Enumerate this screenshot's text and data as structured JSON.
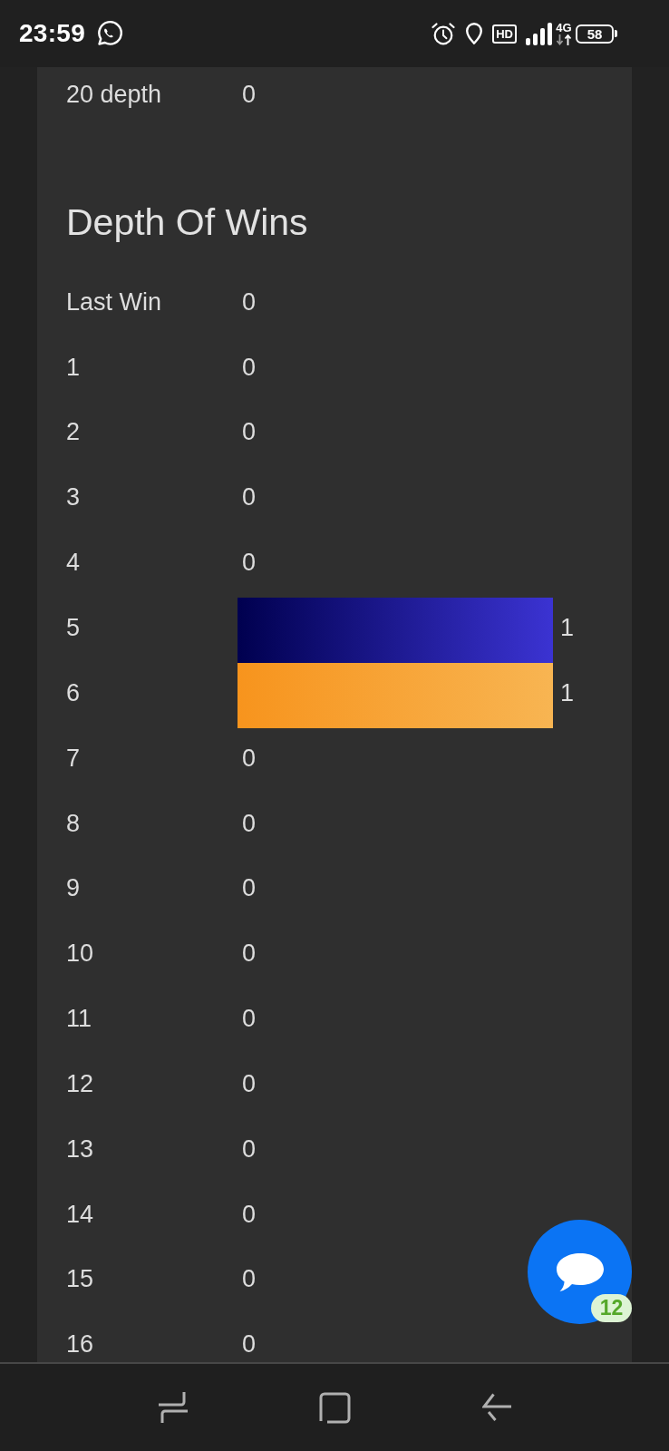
{
  "status_bar": {
    "time": "23:59",
    "hd": "HD",
    "network": "4G",
    "battery": "58"
  },
  "previous_section": {
    "rows": [
      {
        "label": "20 depth",
        "count": "0",
        "kind": "plain"
      }
    ]
  },
  "depth_of_wins": {
    "title": "Depth Of Wins",
    "rows": [
      {
        "label": "Last Win",
        "count": "0",
        "kind": "plain"
      },
      {
        "label": "1",
        "count": "0",
        "kind": "plain"
      },
      {
        "label": "2",
        "count": "0",
        "kind": "plain"
      },
      {
        "label": "3",
        "count": "0",
        "kind": "plain"
      },
      {
        "label": "4",
        "count": "0",
        "kind": "plain"
      },
      {
        "label": "5",
        "count": "1",
        "kind": "bar",
        "color": "#00004f"
      },
      {
        "label": "6",
        "count": "1",
        "kind": "bar",
        "color": "#f7941d"
      },
      {
        "label": "7",
        "count": "0",
        "kind": "plain"
      },
      {
        "label": "8",
        "count": "0",
        "kind": "plain"
      },
      {
        "label": "9",
        "count": "0",
        "kind": "plain"
      },
      {
        "label": "10",
        "count": "0",
        "kind": "plain"
      },
      {
        "label": "11",
        "count": "0",
        "kind": "plain"
      },
      {
        "label": "12",
        "count": "0",
        "kind": "plain"
      },
      {
        "label": "13",
        "count": "0",
        "kind": "plain"
      },
      {
        "label": "14",
        "count": "0",
        "kind": "plain"
      },
      {
        "label": "15",
        "count": "0",
        "kind": "plain"
      },
      {
        "label": "16",
        "count": "0",
        "kind": "plain"
      }
    ]
  },
  "chat_button": {
    "badge": "12"
  }
}
